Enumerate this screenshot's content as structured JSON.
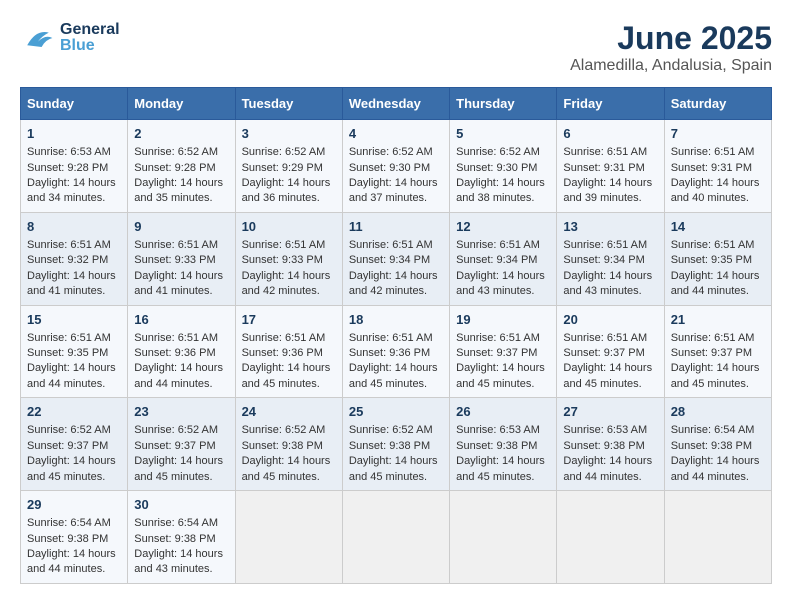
{
  "header": {
    "logo_general": "General",
    "logo_blue": "Blue",
    "title": "June 2025",
    "subtitle": "Alamedilla, Andalusia, Spain"
  },
  "calendar": {
    "days": [
      "Sunday",
      "Monday",
      "Tuesday",
      "Wednesday",
      "Thursday",
      "Friday",
      "Saturday"
    ],
    "weeks": [
      [
        {
          "day": "",
          "empty": true
        },
        {
          "day": "",
          "empty": true
        },
        {
          "day": "",
          "empty": true
        },
        {
          "day": "",
          "empty": true
        },
        {
          "day": "",
          "empty": true
        },
        {
          "day": "",
          "empty": true
        },
        {
          "day": "1",
          "sunrise": "Sunrise: 6:51 AM",
          "sunset": "Sunset: 9:31 PM",
          "daylight": "Daylight: 14 hours and 40 minutes."
        }
      ],
      [
        {
          "day": "1",
          "sunrise": "Sunrise: 6:53 AM",
          "sunset": "Sunset: 9:28 PM",
          "daylight": "Daylight: 14 hours and 34 minutes."
        },
        {
          "day": "2",
          "sunrise": "Sunrise: 6:52 AM",
          "sunset": "Sunset: 9:28 PM",
          "daylight": "Daylight: 14 hours and 35 minutes."
        },
        {
          "day": "3",
          "sunrise": "Sunrise: 6:52 AM",
          "sunset": "Sunset: 9:29 PM",
          "daylight": "Daylight: 14 hours and 36 minutes."
        },
        {
          "day": "4",
          "sunrise": "Sunrise: 6:52 AM",
          "sunset": "Sunset: 9:30 PM",
          "daylight": "Daylight: 14 hours and 37 minutes."
        },
        {
          "day": "5",
          "sunrise": "Sunrise: 6:52 AM",
          "sunset": "Sunset: 9:30 PM",
          "daylight": "Daylight: 14 hours and 38 minutes."
        },
        {
          "day": "6",
          "sunrise": "Sunrise: 6:51 AM",
          "sunset": "Sunset: 9:31 PM",
          "daylight": "Daylight: 14 hours and 39 minutes."
        },
        {
          "day": "7",
          "sunrise": "Sunrise: 6:51 AM",
          "sunset": "Sunset: 9:31 PM",
          "daylight": "Daylight: 14 hours and 40 minutes."
        }
      ],
      [
        {
          "day": "8",
          "sunrise": "Sunrise: 6:51 AM",
          "sunset": "Sunset: 9:32 PM",
          "daylight": "Daylight: 14 hours and 41 minutes."
        },
        {
          "day": "9",
          "sunrise": "Sunrise: 6:51 AM",
          "sunset": "Sunset: 9:33 PM",
          "daylight": "Daylight: 14 hours and 41 minutes."
        },
        {
          "day": "10",
          "sunrise": "Sunrise: 6:51 AM",
          "sunset": "Sunset: 9:33 PM",
          "daylight": "Daylight: 14 hours and 42 minutes."
        },
        {
          "day": "11",
          "sunrise": "Sunrise: 6:51 AM",
          "sunset": "Sunset: 9:34 PM",
          "daylight": "Daylight: 14 hours and 42 minutes."
        },
        {
          "day": "12",
          "sunrise": "Sunrise: 6:51 AM",
          "sunset": "Sunset: 9:34 PM",
          "daylight": "Daylight: 14 hours and 43 minutes."
        },
        {
          "day": "13",
          "sunrise": "Sunrise: 6:51 AM",
          "sunset": "Sunset: 9:34 PM",
          "daylight": "Daylight: 14 hours and 43 minutes."
        },
        {
          "day": "14",
          "sunrise": "Sunrise: 6:51 AM",
          "sunset": "Sunset: 9:35 PM",
          "daylight": "Daylight: 14 hours and 44 minutes."
        }
      ],
      [
        {
          "day": "15",
          "sunrise": "Sunrise: 6:51 AM",
          "sunset": "Sunset: 9:35 PM",
          "daylight": "Daylight: 14 hours and 44 minutes."
        },
        {
          "day": "16",
          "sunrise": "Sunrise: 6:51 AM",
          "sunset": "Sunset: 9:36 PM",
          "daylight": "Daylight: 14 hours and 44 minutes."
        },
        {
          "day": "17",
          "sunrise": "Sunrise: 6:51 AM",
          "sunset": "Sunset: 9:36 PM",
          "daylight": "Daylight: 14 hours and 45 minutes."
        },
        {
          "day": "18",
          "sunrise": "Sunrise: 6:51 AM",
          "sunset": "Sunset: 9:36 PM",
          "daylight": "Daylight: 14 hours and 45 minutes."
        },
        {
          "day": "19",
          "sunrise": "Sunrise: 6:51 AM",
          "sunset": "Sunset: 9:37 PM",
          "daylight": "Daylight: 14 hours and 45 minutes."
        },
        {
          "day": "20",
          "sunrise": "Sunrise: 6:51 AM",
          "sunset": "Sunset: 9:37 PM",
          "daylight": "Daylight: 14 hours and 45 minutes."
        },
        {
          "day": "21",
          "sunrise": "Sunrise: 6:51 AM",
          "sunset": "Sunset: 9:37 PM",
          "daylight": "Daylight: 14 hours and 45 minutes."
        }
      ],
      [
        {
          "day": "22",
          "sunrise": "Sunrise: 6:52 AM",
          "sunset": "Sunset: 9:37 PM",
          "daylight": "Daylight: 14 hours and 45 minutes."
        },
        {
          "day": "23",
          "sunrise": "Sunrise: 6:52 AM",
          "sunset": "Sunset: 9:37 PM",
          "daylight": "Daylight: 14 hours and 45 minutes."
        },
        {
          "day": "24",
          "sunrise": "Sunrise: 6:52 AM",
          "sunset": "Sunset: 9:38 PM",
          "daylight": "Daylight: 14 hours and 45 minutes."
        },
        {
          "day": "25",
          "sunrise": "Sunrise: 6:52 AM",
          "sunset": "Sunset: 9:38 PM",
          "daylight": "Daylight: 14 hours and 45 minutes."
        },
        {
          "day": "26",
          "sunrise": "Sunrise: 6:53 AM",
          "sunset": "Sunset: 9:38 PM",
          "daylight": "Daylight: 14 hours and 45 minutes."
        },
        {
          "day": "27",
          "sunrise": "Sunrise: 6:53 AM",
          "sunset": "Sunset: 9:38 PM",
          "daylight": "Daylight: 14 hours and 44 minutes."
        },
        {
          "day": "28",
          "sunrise": "Sunrise: 6:54 AM",
          "sunset": "Sunset: 9:38 PM",
          "daylight": "Daylight: 14 hours and 44 minutes."
        }
      ],
      [
        {
          "day": "29",
          "sunrise": "Sunrise: 6:54 AM",
          "sunset": "Sunset: 9:38 PM",
          "daylight": "Daylight: 14 hours and 44 minutes."
        },
        {
          "day": "30",
          "sunrise": "Sunrise: 6:54 AM",
          "sunset": "Sunset: 9:38 PM",
          "daylight": "Daylight: 14 hours and 43 minutes."
        },
        {
          "day": "",
          "empty": true
        },
        {
          "day": "",
          "empty": true
        },
        {
          "day": "",
          "empty": true
        },
        {
          "day": "",
          "empty": true
        },
        {
          "day": "",
          "empty": true
        }
      ]
    ]
  }
}
